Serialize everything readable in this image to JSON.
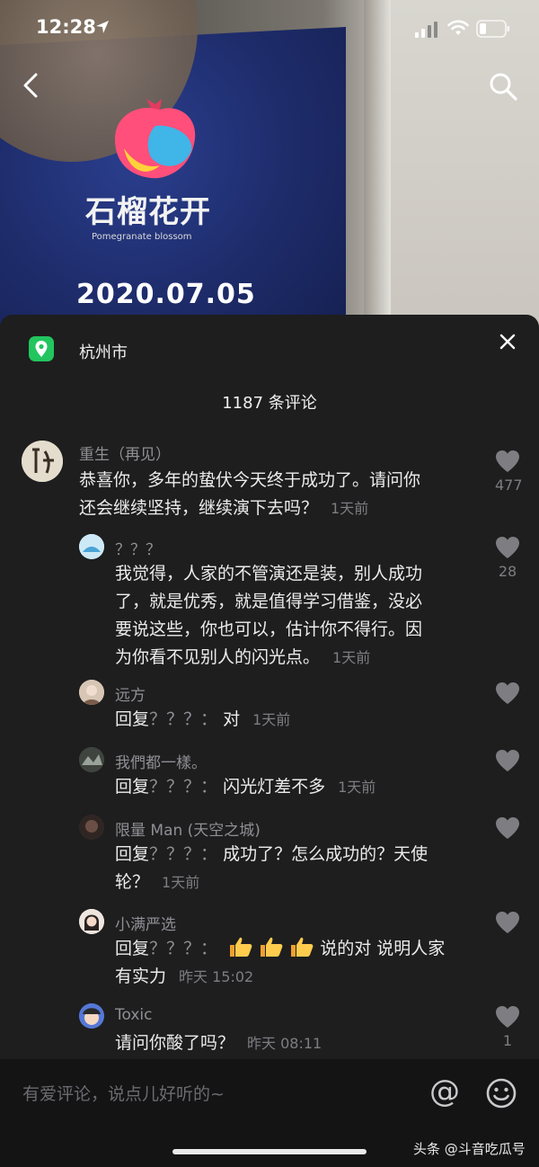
{
  "status": {
    "time": "12:28"
  },
  "poster": {
    "brand": "石榴花开",
    "brand_sub": "Pomegranate blossom",
    "date": "2020.07.05"
  },
  "panel": {
    "location": "杭州市",
    "comment_count": "1187 条评论"
  },
  "comments": [
    {
      "author": "重生（再见）",
      "text_lines": [
        "恭喜你，多年的蛰伏今天终于成功了。请问你",
        "还会继续坚持，继续演下去吗？"
      ],
      "time": "1天前",
      "likes": "477"
    },
    {
      "author": "？？？",
      "text_lines": [
        "我觉得，人家的不管演还是装，别人成功",
        "了，就是优秀，就是值得学习借鉴，没必",
        "要说这些，你也可以，估计你不得行。因",
        "为你看不见别人的闪光点。"
      ],
      "time": "1天前",
      "likes": "28"
    },
    {
      "author": "远方",
      "reply_prefix": "回复",
      "reply_to": "？？？：",
      "text": "对",
      "time": "1天前"
    },
    {
      "author": "我們都一樣。",
      "reply_prefix": "回复",
      "reply_to": "？？？：",
      "text": "闪光灯差不多",
      "time": "1天前"
    },
    {
      "author": "限量 Man (天空之城)",
      "reply_prefix": "回复",
      "reply_to": "？？？：",
      "text_line1": "成功了？怎么成功的？天使",
      "text_line2": "轮？",
      "time": "1天前"
    },
    {
      "author": "小满严选",
      "reply_prefix": "回复",
      "reply_to": "？？？：",
      "text_line1": "说的对 说明人家",
      "text_line2": "有实力",
      "time": "昨天 15:02"
    },
    {
      "author": "Toxic",
      "text": "请问你酸了吗？",
      "time": "昨天 08:11",
      "likes": "1"
    }
  ],
  "input": {
    "placeholder": "有爱评论，说点儿好听的~",
    "at_symbol": "@"
  },
  "watermark": "头条 @斗音吃瓜号",
  "icons": {
    "location": "location-pin-icon",
    "back": "chevron-left-icon",
    "search": "search-icon",
    "close": "close-icon",
    "heart": "heart-icon",
    "emoji": "smiley-icon",
    "thumbs_up": "thumbs-up-icon"
  },
  "colors": {
    "location_badge": "#22c55e",
    "panel": "#1e1e1f",
    "muted_text": "#8f8f94"
  }
}
